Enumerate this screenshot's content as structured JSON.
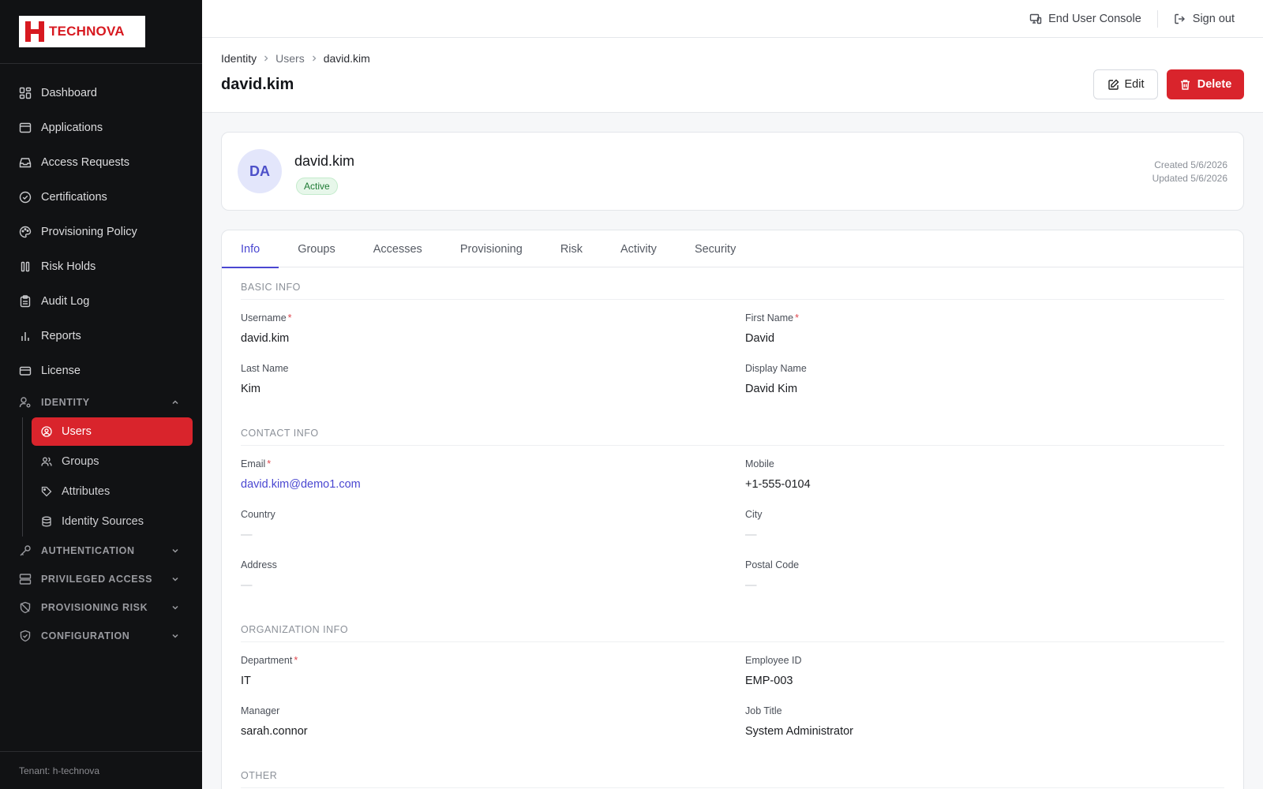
{
  "brand": {
    "name": "TECHNOVA",
    "logo_color": "#d71920"
  },
  "sidebar": {
    "items": [
      {
        "label": "Dashboard",
        "icon": "dashboard-icon"
      },
      {
        "label": "Applications",
        "icon": "window-icon"
      },
      {
        "label": "Access Requests",
        "icon": "inbox-icon"
      },
      {
        "label": "Certifications",
        "icon": "check-circle-icon"
      },
      {
        "label": "Provisioning Policy",
        "icon": "palette-icon"
      },
      {
        "label": "Risk Holds",
        "icon": "pause-icon"
      },
      {
        "label": "Audit Log",
        "icon": "clipboard-icon"
      },
      {
        "label": "Reports",
        "icon": "bar-chart-icon"
      },
      {
        "label": "License",
        "icon": "card-icon"
      }
    ],
    "identity_section": {
      "label": "IDENTITY",
      "children": [
        {
          "label": "Users",
          "icon": "user-circle-icon",
          "active": true
        },
        {
          "label": "Groups",
          "icon": "users-icon"
        },
        {
          "label": "Attributes",
          "icon": "tag-icon"
        },
        {
          "label": "Identity Sources",
          "icon": "database-icon"
        }
      ]
    },
    "sections": [
      {
        "label": "AUTHENTICATION",
        "icon": "key-icon"
      },
      {
        "label": "PRIVILEGED ACCESS",
        "icon": "server-icon"
      },
      {
        "label": "PROVISIONING RISK",
        "icon": "shield-off-icon"
      },
      {
        "label": "CONFIGURATION",
        "icon": "shield-check-icon"
      }
    ],
    "footer": "Tenant: h-technova",
    "active_color": "#d9242c"
  },
  "topbar": {
    "console_label": "End User Console",
    "signout_label": "Sign out"
  },
  "header": {
    "breadcrumb": [
      "Identity",
      "Users",
      "david.kim"
    ],
    "title": "david.kim",
    "edit_label": "Edit",
    "delete_label": "Delete"
  },
  "profile": {
    "initials": "DA",
    "name": "david.kim",
    "status": "Active",
    "created": "Created 5/6/2026",
    "updated": "Updated 5/6/2026"
  },
  "tabs": [
    "Info",
    "Groups",
    "Accesses",
    "Provisioning",
    "Risk",
    "Activity",
    "Security"
  ],
  "active_tab": "Info",
  "info": {
    "basic": {
      "title": "BASIC INFO",
      "username": {
        "label": "Username",
        "value": "david.kim"
      },
      "first_name": {
        "label": "First Name",
        "value": "David"
      },
      "last_name": {
        "label": "Last Name",
        "value": "Kim"
      },
      "display_name": {
        "label": "Display Name",
        "value": "David Kim"
      }
    },
    "contact": {
      "title": "CONTACT INFO",
      "email": {
        "label": "Email",
        "value": "david.kim@demo1.com"
      },
      "mobile": {
        "label": "Mobile",
        "value": "+1-555-0104"
      },
      "country": {
        "label": "Country",
        "value": "—"
      },
      "city": {
        "label": "City",
        "value": "—"
      },
      "address": {
        "label": "Address",
        "value": "—"
      },
      "postal_code": {
        "label": "Postal Code",
        "value": "—"
      }
    },
    "organization": {
      "title": "ORGANIZATION INFO",
      "department": {
        "label": "Department",
        "value": "IT"
      },
      "employee_id": {
        "label": "Employee ID",
        "value": "EMP-003"
      },
      "manager": {
        "label": "Manager",
        "value": "sarah.connor"
      },
      "job_title": {
        "label": "Job Title",
        "value": "System Administrator"
      }
    },
    "other": {
      "title": "OTHER"
    }
  }
}
